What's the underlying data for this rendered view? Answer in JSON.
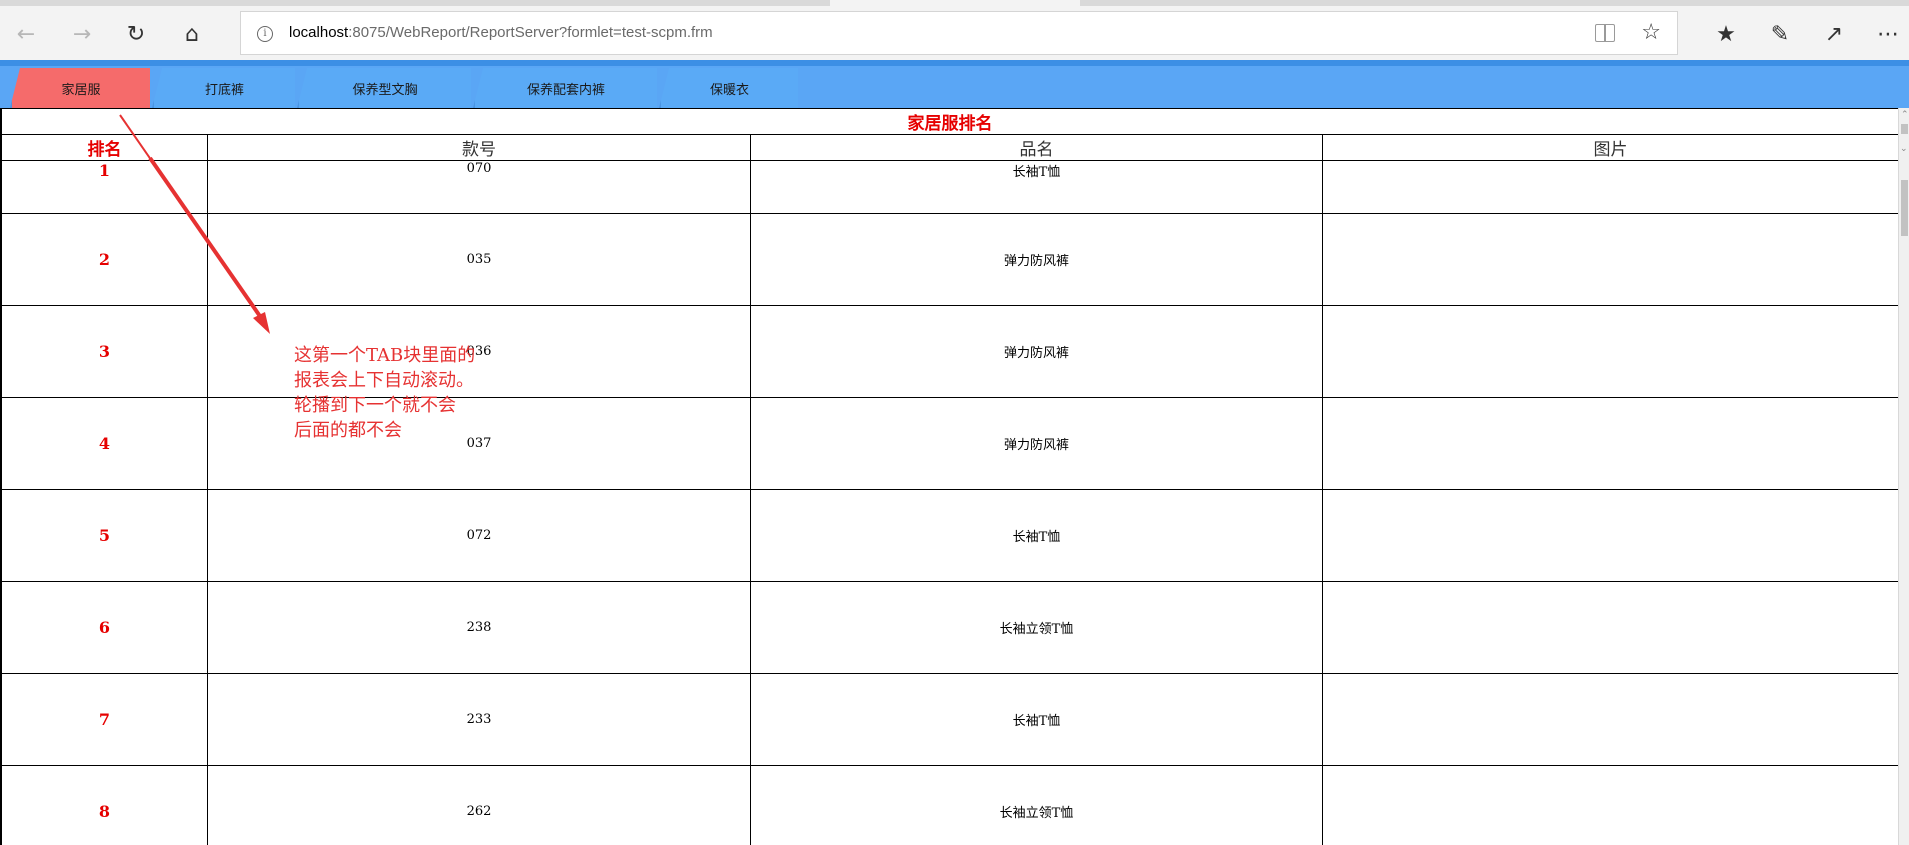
{
  "browser": {
    "url_host": "localhost",
    "url_rest": ":8075/WebReport/ReportServer?formlet=test-scpm.frm",
    "icons": {
      "back": "back-arrow-icon",
      "forward": "forward-arrow-icon",
      "refresh": "refresh-icon",
      "home": "home-icon",
      "info": "info-icon",
      "reading": "reading-view-icon",
      "favorite": "star-icon",
      "favorites_hub": "favorites-hub-icon",
      "notes": "pen-icon",
      "share": "share-icon",
      "more": "more-icon"
    }
  },
  "tabs": [
    {
      "label": "家居服",
      "active": true
    },
    {
      "label": "打底裤",
      "active": false
    },
    {
      "label": "保养型文胸",
      "active": false
    },
    {
      "label": "保养配套内裤",
      "active": false
    },
    {
      "label": "保暖衣",
      "active": false
    }
  ],
  "report": {
    "title": "家居服排名",
    "columns": [
      "排名",
      "款号",
      "品名",
      "图片"
    ],
    "rows": [
      {
        "rank": "1",
        "code": "070",
        "name": "长袖T恤",
        "image": ""
      },
      {
        "rank": "2",
        "code": "035",
        "name": "弹力防风裤",
        "image": ""
      },
      {
        "rank": "3",
        "code": "036",
        "name": "弹力防风裤",
        "image": ""
      },
      {
        "rank": "4",
        "code": "037",
        "name": "弹力防风裤",
        "image": ""
      },
      {
        "rank": "5",
        "code": "072",
        "name": "长袖T恤",
        "image": ""
      },
      {
        "rank": "6",
        "code": "238",
        "name": "长袖立领T恤",
        "image": ""
      },
      {
        "rank": "7",
        "code": "233",
        "name": "长袖T恤",
        "image": ""
      },
      {
        "rank": "8",
        "code": "262",
        "name": "长袖立领T恤",
        "image": ""
      }
    ]
  },
  "annotation": {
    "lines": [
      "这第一个TAB块里面的",
      "报表会上下自动滚动。",
      "轮播到下一个就不会",
      "后面的都不会"
    ],
    "color": "#e63232"
  },
  "colors": {
    "active_tab": "#f56b6b",
    "tab": "#5aaaf6",
    "tabbar": "#3c8fe5",
    "report_red": "#e60000"
  }
}
